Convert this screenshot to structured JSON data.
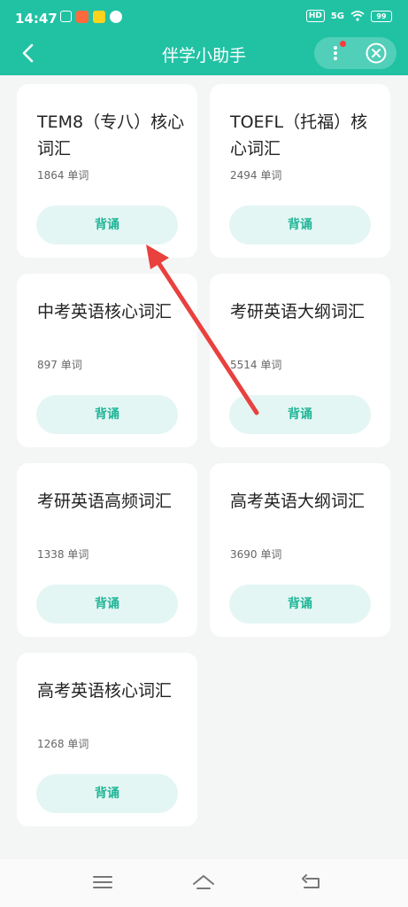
{
  "status_bar": {
    "time": "14:47",
    "hd": "HD",
    "network": "5G",
    "battery": "99"
  },
  "header": {
    "title": "伴学小助手"
  },
  "cards": [
    {
      "title": "TEM8（专八）核心词汇",
      "count": "1864 单词",
      "button": "背诵"
    },
    {
      "title": "TOEFL（托福）核心词汇",
      "count": "2494 单词",
      "button": "背诵"
    },
    {
      "title": "中考英语核心词汇",
      "count": "897 单词",
      "button": "背诵"
    },
    {
      "title": "考研英语大纲词汇",
      "count": "5514 单词",
      "button": "背诵"
    },
    {
      "title": "考研英语高频词汇",
      "count": "1338 单词",
      "button": "背诵"
    },
    {
      "title": "高考英语大纲词汇",
      "count": "3690 单词",
      "button": "背诵"
    },
    {
      "title": "高考英语核心词汇",
      "count": "1268 单词",
      "button": "背诵"
    }
  ],
  "colors": {
    "accent": "#21c2a4",
    "button_bg": "#e4f6f4",
    "button_text": "#1fb596",
    "annotation_arrow": "#e8413e"
  },
  "icons": {
    "back": "chevron-left-icon",
    "more": "more-vertical-icon",
    "close": "close-circle-icon",
    "nav_menu": "menu-icon",
    "nav_home": "home-icon",
    "nav_back": "back-icon"
  }
}
